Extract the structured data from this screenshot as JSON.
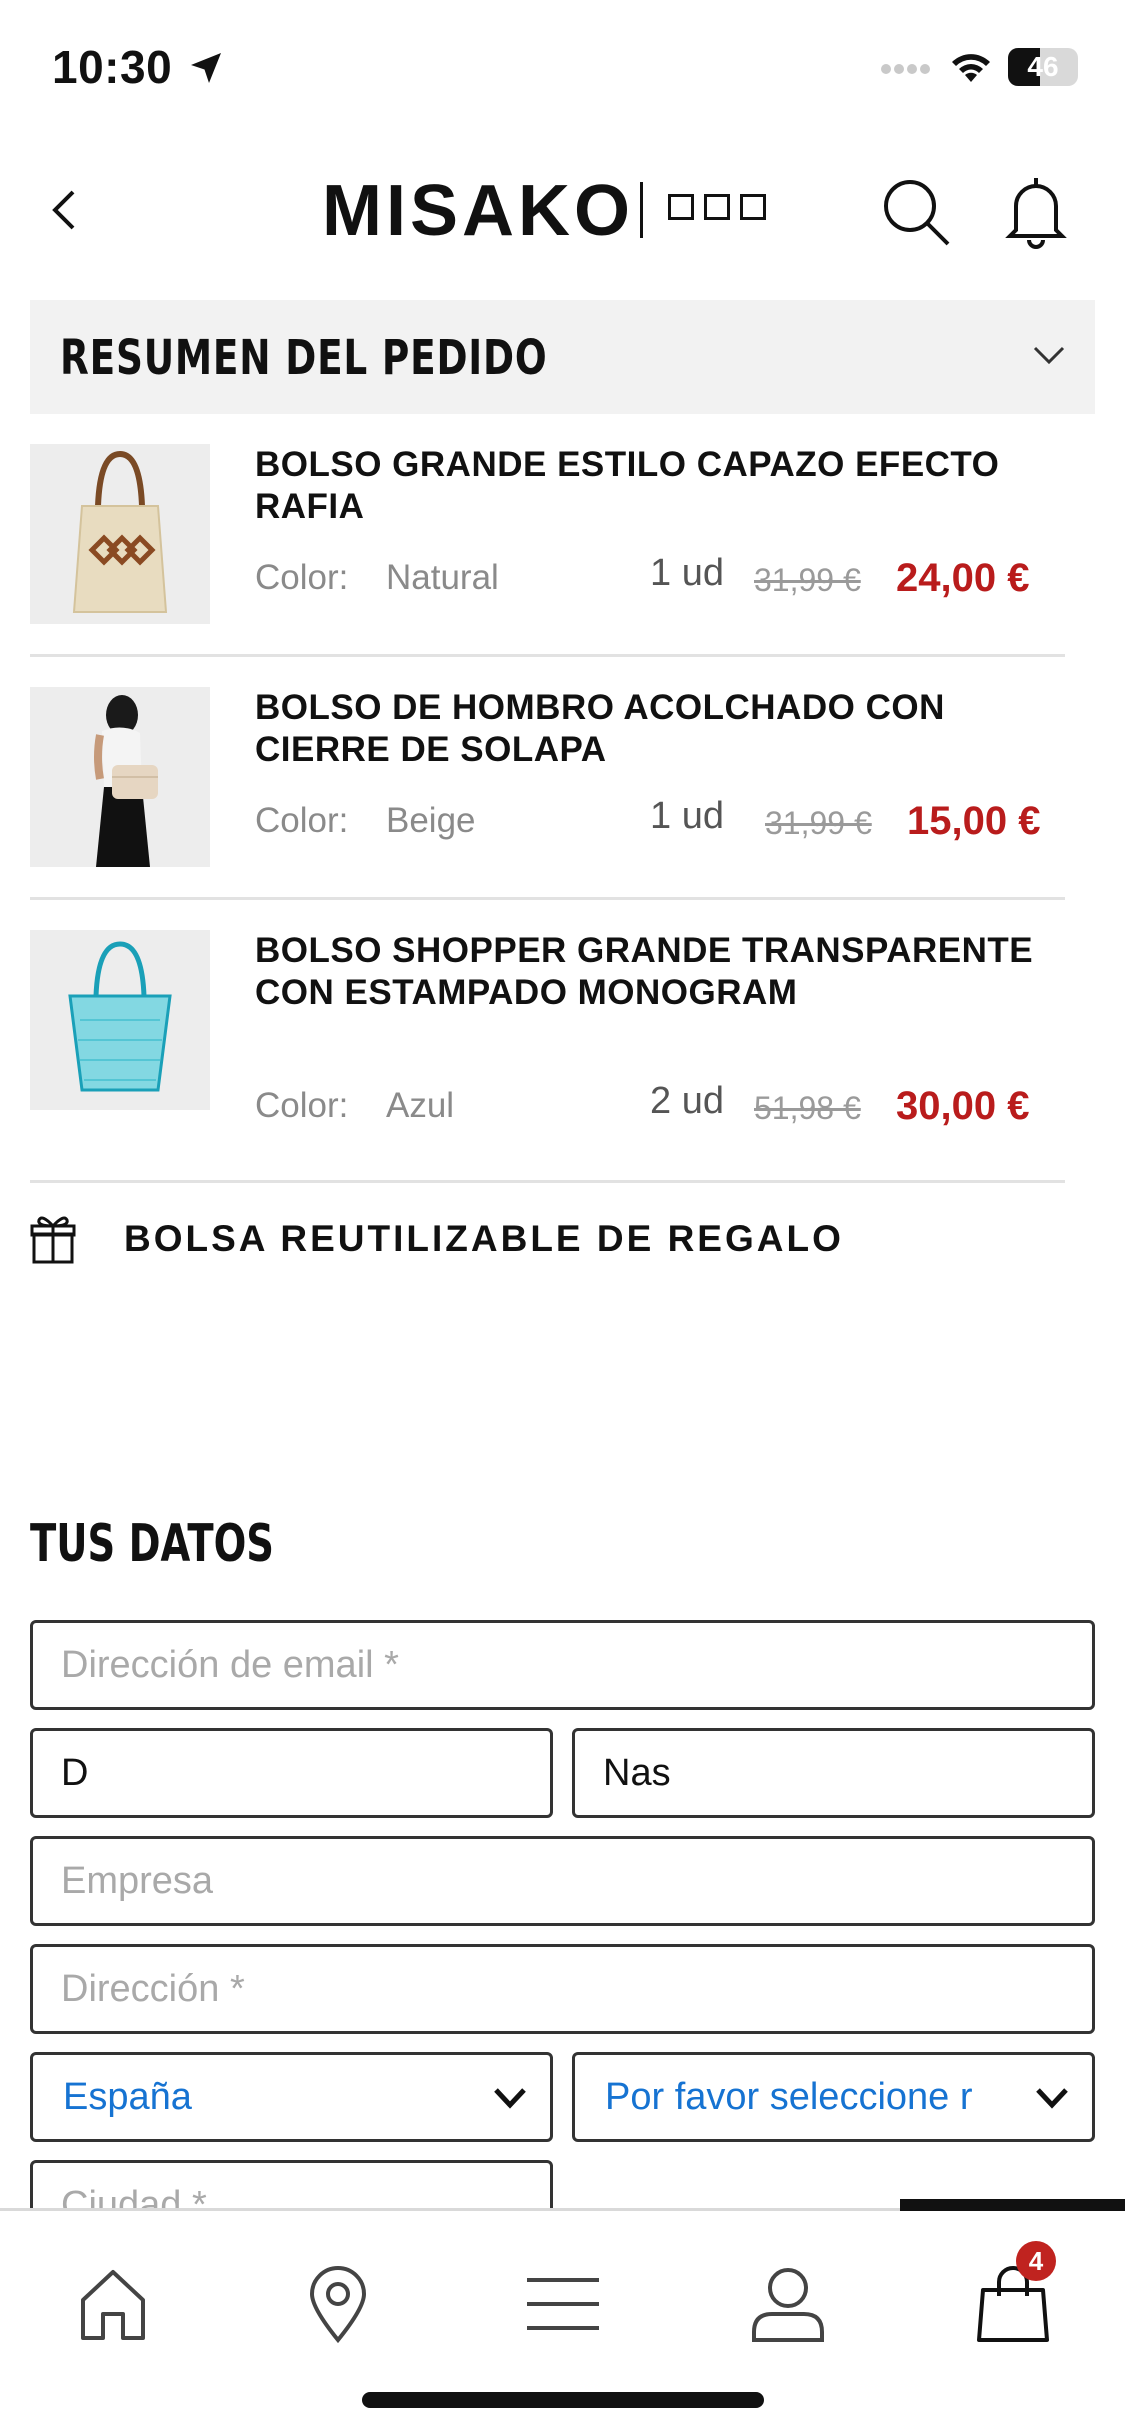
{
  "status_bar": {
    "time": "10:30",
    "battery": "46",
    "icons": [
      "location-arrow-icon",
      "signal-dots-icon",
      "wifi-icon",
      "battery-icon"
    ]
  },
  "header": {
    "logo": "MISAKO",
    "icons": [
      "back-icon",
      "search-icon",
      "bell-icon"
    ]
  },
  "order_summary": {
    "title": "RESUMEN DEL PEDIDO",
    "items": [
      {
        "name": "BOLSO GRANDE ESTILO CAPAZO EFECTO RAFIA",
        "color_label": "Color:",
        "color": "Natural",
        "qty": "1 ud",
        "old_price": "31,99 €",
        "price": "24,00 €"
      },
      {
        "name": "BOLSO DE HOMBRO ACOLCHADO CON CIERRE DE SOLAPA",
        "color_label": "Color:",
        "color": "Beige",
        "qty": "1 ud",
        "old_price": "31,99 €",
        "price": "15,00 €"
      },
      {
        "name": "BOLSO SHOPPER GRANDE TRANSPARENTE CON ESTAMPADO MONOGRAM",
        "color_label": "Color:",
        "color": "Azul",
        "qty": "2 ud",
        "old_price": "51,98 €",
        "price": "30,00 €"
      }
    ],
    "gift": "BOLSA REUTILIZABLE DE REGALO"
  },
  "your_data": {
    "title": "TUS DATOS",
    "email_placeholder": "Dirección de email *",
    "first_name_value": "D",
    "last_name_value": "Nas",
    "company_placeholder": "Empresa",
    "address_placeholder": "Dirección *",
    "country_value": "España",
    "region_value": "Por favor seleccione r",
    "city_placeholder": "Ciudad *"
  },
  "bottom_nav": {
    "items": [
      "home-icon",
      "location-pin-icon",
      "menu-icon",
      "user-icon",
      "cart-icon"
    ],
    "cart_count": "4",
    "active": "cart-icon"
  },
  "colors": {
    "price_red": "#b91c1c",
    "select_blue": "#1673d2",
    "badge_red": "#c0231f",
    "summary_bg": "#f2f2f2"
  }
}
